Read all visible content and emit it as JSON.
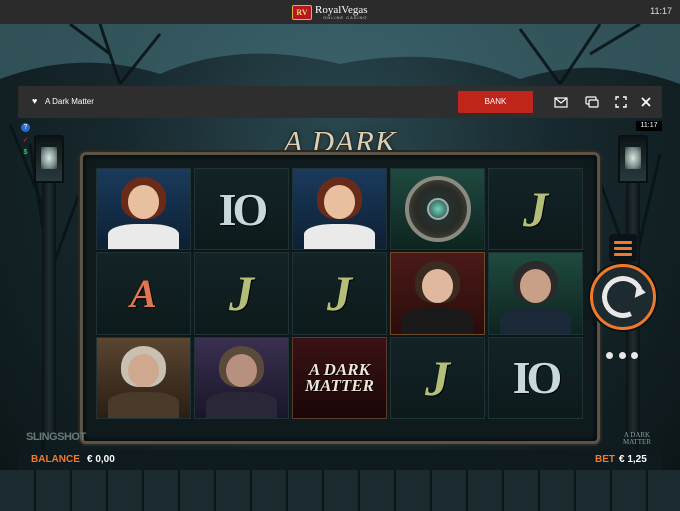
{
  "status_bar": {
    "clock": "11:17"
  },
  "casino": {
    "brand_badge": "RV",
    "brand_name": "RoyalVegas",
    "brand_tagline": "ONLINE CASINO"
  },
  "game_bar": {
    "title": "A Dark Matter",
    "bank_label": "BANK",
    "icons": [
      "heart-icon",
      "mail-icon",
      "chat-icon",
      "fullscreen-icon",
      "close-icon"
    ]
  },
  "game": {
    "clock": "11:17",
    "logo": "A DARK MATTER",
    "provider": "SLINGSHOT",
    "mini_logo_line1": "A DARK",
    "mini_logo_line2": "MATTER",
    "mini_icons": [
      "?",
      "✓",
      "$"
    ]
  },
  "reels": [
    [
      {
        "type": "portrait",
        "name": "woman",
        "style": "blue"
      },
      {
        "type": "text",
        "label": "A",
        "kind": "ace"
      },
      {
        "type": "portrait",
        "name": "old-woman",
        "style": "brown"
      }
    ],
    [
      {
        "type": "text",
        "label": "IO",
        "kind": "ten"
      },
      {
        "type": "text",
        "label": "J",
        "kind": "jack"
      },
      {
        "type": "portrait",
        "name": "old-man",
        "style": "purple"
      }
    ],
    [
      {
        "type": "portrait",
        "name": "woman",
        "style": "blue"
      },
      {
        "type": "text",
        "label": "J",
        "kind": "jack"
      },
      {
        "type": "logo",
        "line1": "A DARK",
        "line2": "MATTER",
        "style": "maroon"
      }
    ],
    [
      {
        "type": "wild",
        "name": "amulet",
        "style": "green"
      },
      {
        "type": "portrait",
        "name": "detective",
        "style": "red"
      },
      {
        "type": "text",
        "label": "J",
        "kind": "jack"
      }
    ],
    [
      {
        "type": "text",
        "label": "J",
        "kind": "jack"
      },
      {
        "type": "portrait",
        "name": "policeman",
        "style": "green"
      },
      {
        "type": "text",
        "label": "IO",
        "kind": "ten"
      }
    ]
  ],
  "footer": {
    "balance_label": "BALANCE",
    "balance_value": "€ 0,00",
    "bet_label": "BET",
    "bet_value": "€ 1,25"
  },
  "colors": {
    "accent": "#f07a2a",
    "bank": "#c0251c",
    "bar": "#2e2e2e"
  }
}
